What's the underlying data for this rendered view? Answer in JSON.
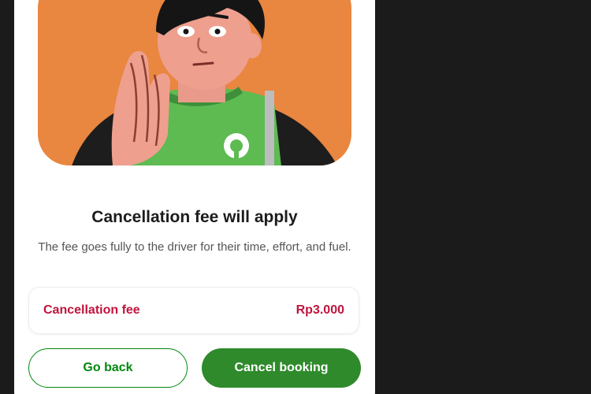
{
  "dialog": {
    "title": "Cancellation fee will apply",
    "description": "The fee goes fully to the driver for their time, effort, and fuel.",
    "fee": {
      "label": "Cancellation fee",
      "value": "Rp3.000"
    },
    "buttons": {
      "back_label": "Go back",
      "cancel_label": "Cancel booking"
    },
    "illustration_icon": "pleading-driver-illustration"
  },
  "colors": {
    "accent_green": "#2f8a2c",
    "fee_red": "#c0143c",
    "illustration_bg": "#e9863f",
    "jacket_green": "#5dbb52"
  }
}
